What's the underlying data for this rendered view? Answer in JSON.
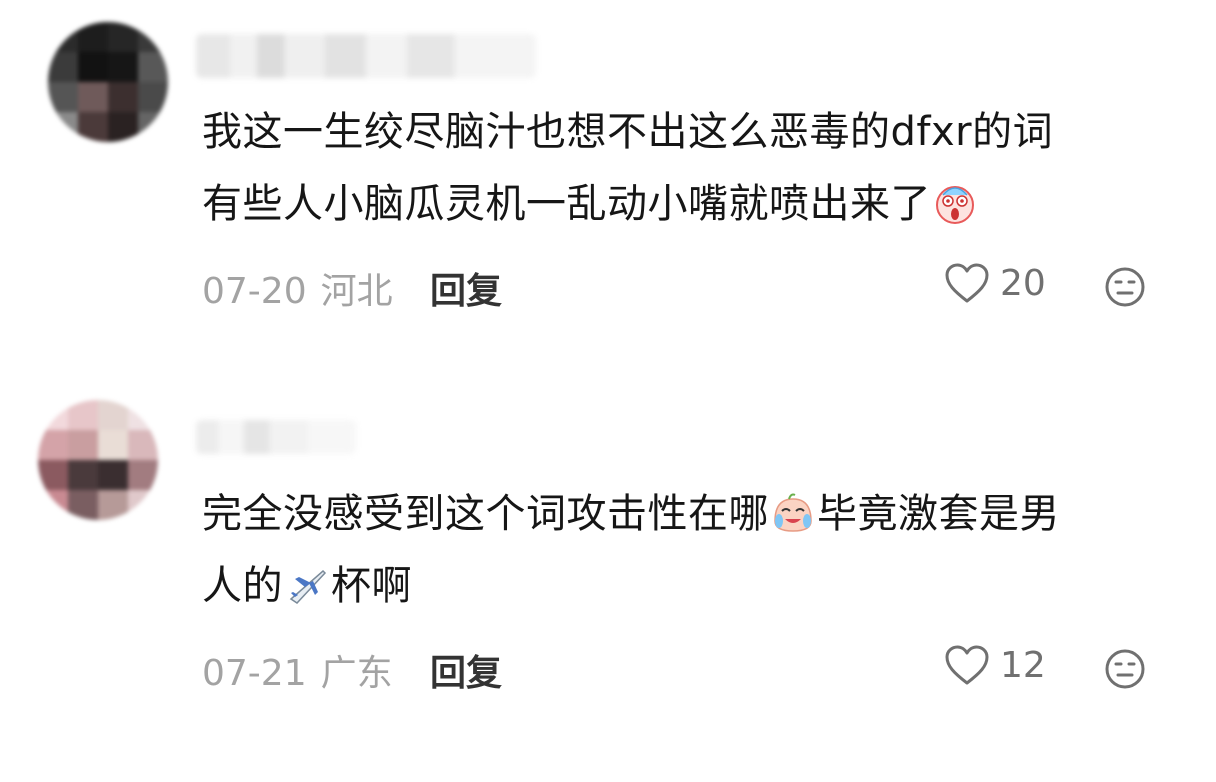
{
  "comments": [
    {
      "text": "我这一生绞尽脑汁也想不出这么恶毒的dfxr的词有些人小脑瓜灵机一乱动小嘴就喷出来了",
      "line1": "我这一生绞尽脑汁也想不出这么恶毒的dfxr的词",
      "line2": "有些人小脑瓜灵机一乱动小嘴就喷出来了",
      "emoji_icon": "screaming-face-emoji",
      "date": "07-20",
      "location": "河北",
      "reply_label": "回复",
      "likes": "20"
    },
    {
      "text": "完全没感受到这个词攻击性在哪毕竟激套是男人的杯啊",
      "line1_a": "完全没感受到这个词攻击性在哪",
      "line1_b": "毕竟激套是男",
      "line2_a": "人的",
      "line2_b": "杯啊",
      "emoji_icon_1": "crying-face-emoji",
      "emoji_icon_2": "airplane-emoji",
      "date": "07-21",
      "location": "广东",
      "reply_label": "回复",
      "likes": "12"
    }
  ],
  "colors": {
    "text": "#161616",
    "meta": "#a3a3a3",
    "reply": "#333333",
    "icon": "#707070"
  }
}
